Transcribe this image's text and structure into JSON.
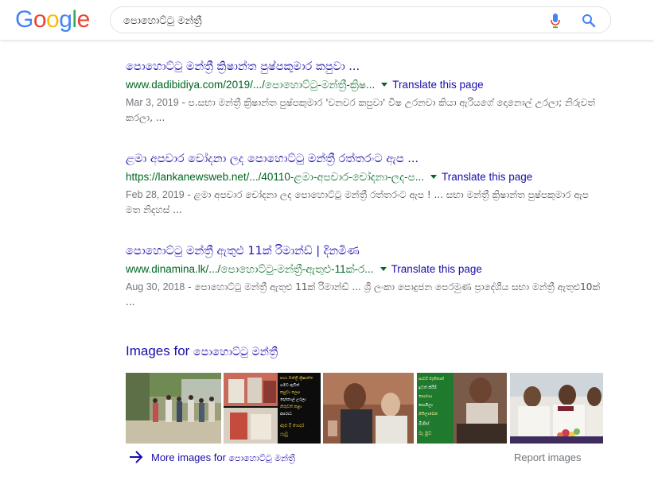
{
  "logo": {
    "letters": [
      "G",
      "o",
      "o",
      "g",
      "l",
      "e"
    ],
    "colors": [
      "#4285F4",
      "#EA4335",
      "#FBBC05",
      "#4285F4",
      "#34A853",
      "#EA4335"
    ]
  },
  "search": {
    "query": "පොහොට්ටු මන්ත්‍රී"
  },
  "results": [
    {
      "title": "පොහොට්ටු මන්ත්‍රී ක්‍රිෂාන්ත පුෂ්පකුමාර කපුවා ...",
      "url": "www.dadibidiya.com/2019/.../පොහොට්ටු-මන්ත්‍රී-ක්‍රිෂ...",
      "translate": "Translate this page",
      "date": "Mar 3, 2019",
      "snippet": " - ප.සභා මන්ත්‍රී ක්‍රිෂාන්ත පුෂ්පකුමාර 'වනවර කපුවා' විෂ උරනවා කියා ඇරියගේ දොනොල් උරලා; නිරුවත් කරලා, ..."
    },
    {
      "title": "ළමා අපචාර චෝදනා ලද පොහොට්ටු මන්ත්‍රී රත්තරංට ඇප ...",
      "url": "https://lankanewsweb.net/.../40110-ළමා-අපචාර-චෝදනා-ලද-ප...",
      "translate": "Translate this page",
      "date": "Feb 28, 2019",
      "snippet": " - ළමා අපචාර චෝදනා ලද පොහොට්ටු මන්ත්‍රී රත්තරංට ඇප ! ... සභා මන්ත්‍රී ක්‍රිෂාන්ත පුෂ්පකුමාර ඇප මත නිදහස් ..."
    },
    {
      "title": "පොහොට්ටු මන්ත්‍රී ඇතුළු 11ක් රිමාන්ඩ් | දිනමිණ",
      "url": "www.dinamina.lk/.../පොහොට්ටු-මන්ත්‍රී-ඇතුළු-11ක්-ර...",
      "translate": "Translate this page",
      "date": "Aug 30, 2018",
      "snippet": " - පොහොට්ටු මන්ත්‍රී ඇතුළු 11ක් රිමාන්ඩ් ... ශ්‍රී ලංකා පොදුජන පෙරමුණ ප්‍රාදේශීය සභා මන්ත්‍රී ඇතුළු10ක් ..."
    }
  ],
  "images": {
    "heading_prefix": "Images for ",
    "heading_query": "පොහොට්ටු මන්ත්‍රී",
    "thumb_texts": {
      "poster": [
        "සභා මන්ත්‍රී ක්‍රිෂාන්ත",
        "ගමට ඇවිත්",
        "කපුවා ලෙස",
        "දොනොල් උරලා",
        "නිරුවත් කළා",
        "අපරාධ",
        "ඇප දී ගෙදර",
        "යැවූ"
      ],
      "green": [
        "පාර්ට් මැතිතාත්",
        "ඉවත් කිරීම්",
        "පොරහා",
        "සොඹිලා",
        "ගිතිලාබෙන",
        "මිනිස්",
        "බෑ මුව"
      ],
      "banner": [
        "ඇත්ත",
        "පැමිණි මනීෂා",
        "ගාලුත් නොවේ"
      ]
    },
    "more_prefix": "More images for ",
    "more_query": "පොහොට්ටු මන්ත්‍රී",
    "report": "Report images"
  }
}
